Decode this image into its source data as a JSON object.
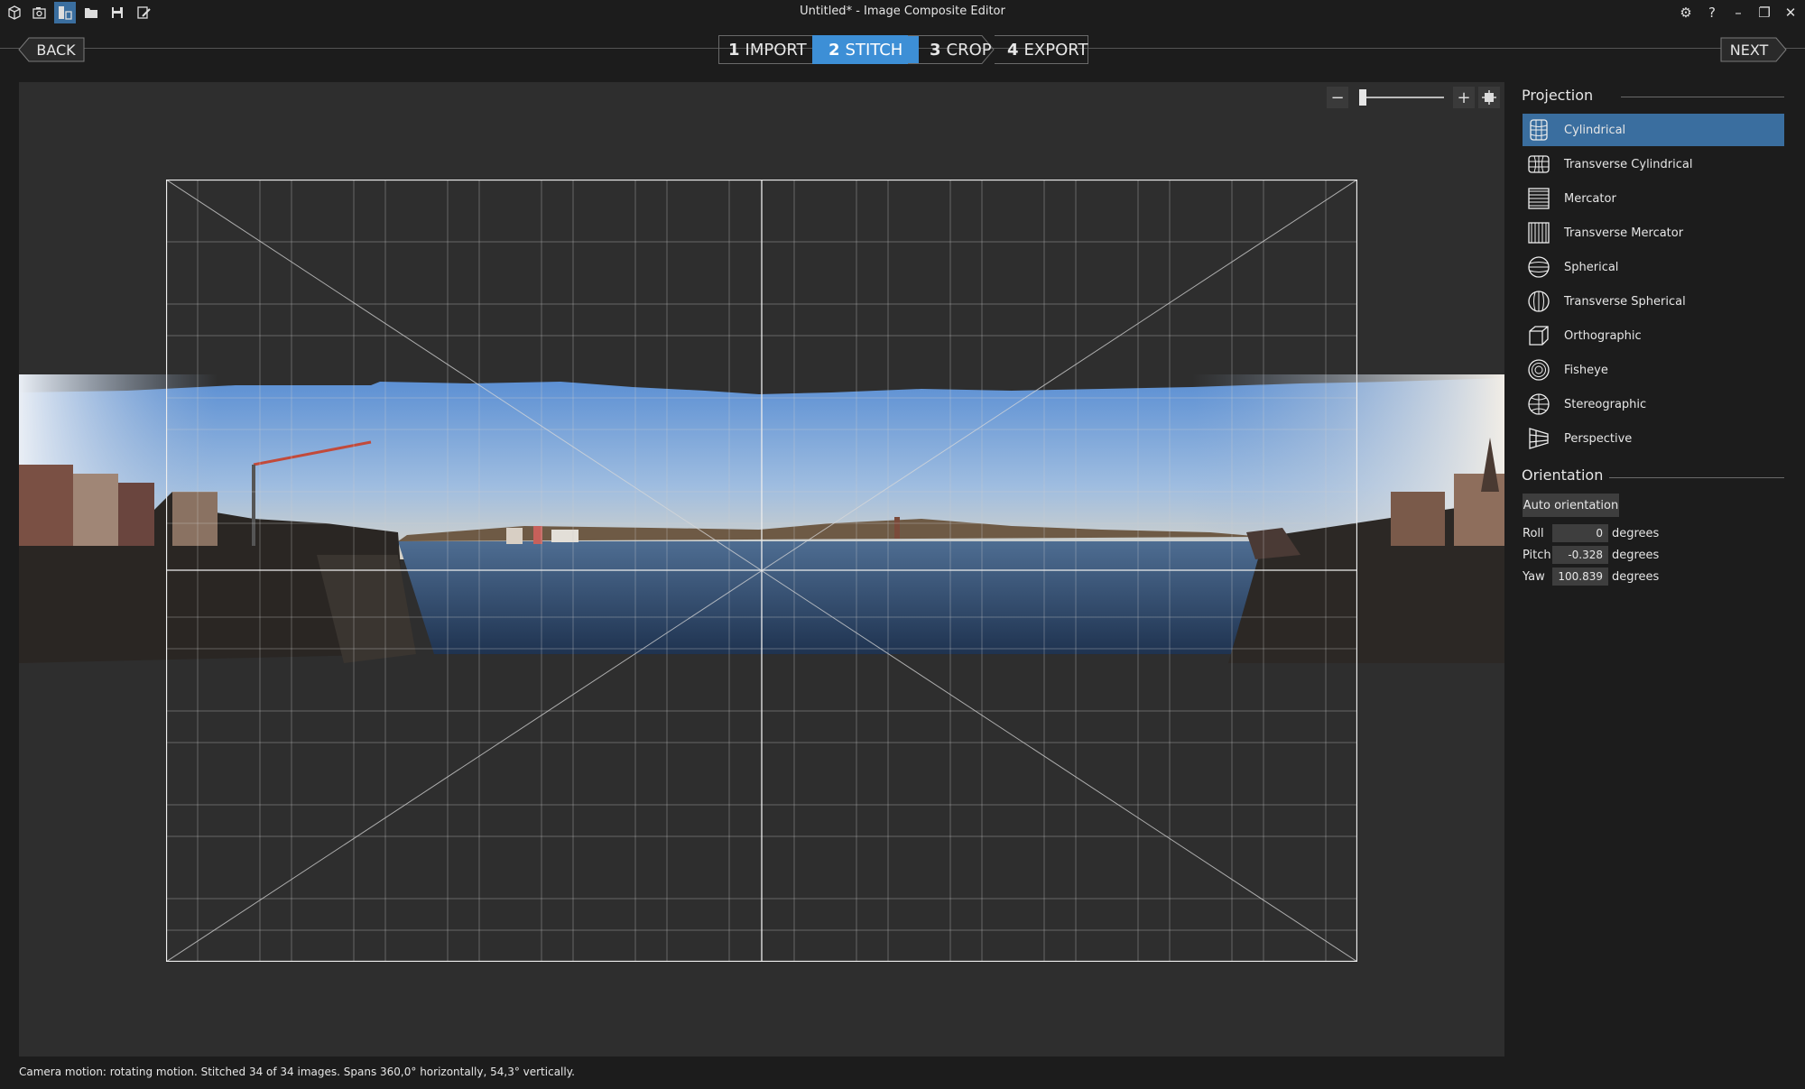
{
  "window": {
    "title": "Untitled* - Image Composite Editor"
  },
  "toolbar": {
    "icons": [
      "app-logo-icon",
      "new-panorama-from-images-icon",
      "new-panorama-from-video-icon",
      "open-folder-icon",
      "save-icon",
      "save-as-icon"
    ]
  },
  "window_controls": {
    "settings": "⚙",
    "help": "?",
    "minimize": "–",
    "restore": "❐",
    "close": "✕"
  },
  "nav": {
    "back_label": "BACK",
    "next_label": "NEXT",
    "steps": [
      {
        "num": "1",
        "label": "IMPORT"
      },
      {
        "num": "2",
        "label": "STITCH"
      },
      {
        "num": "3",
        "label": "CROP"
      },
      {
        "num": "4",
        "label": "EXPORT"
      }
    ],
    "active_step": 1
  },
  "zoom": {
    "minus": "−",
    "plus": "+",
    "level": 0.05
  },
  "projection": {
    "title": "Projection",
    "items": [
      "Cylindrical",
      "Transverse Cylindrical",
      "Mercator",
      "Transverse Mercator",
      "Spherical",
      "Transverse Spherical",
      "Orthographic",
      "Fisheye",
      "Stereographic",
      "Perspective"
    ],
    "selected": "Cylindrical"
  },
  "orientation": {
    "title": "Orientation",
    "auto_label": "Auto orientation",
    "roll_label": "Roll",
    "roll_value": "0",
    "pitch_label": "Pitch",
    "pitch_value": "-0.328",
    "yaw_label": "Yaw",
    "yaw_value": "100.839",
    "unit": "degrees"
  },
  "status": {
    "text": "Camera motion: rotating motion. Stitched 34 of 34 images. Spans 360,0° horizontally, 54,3° vertically."
  },
  "colors": {
    "accent": "#3d8fd6",
    "selected": "#3a6e9f",
    "canvas": "#2e2e2e",
    "background": "#1c1c1c"
  }
}
